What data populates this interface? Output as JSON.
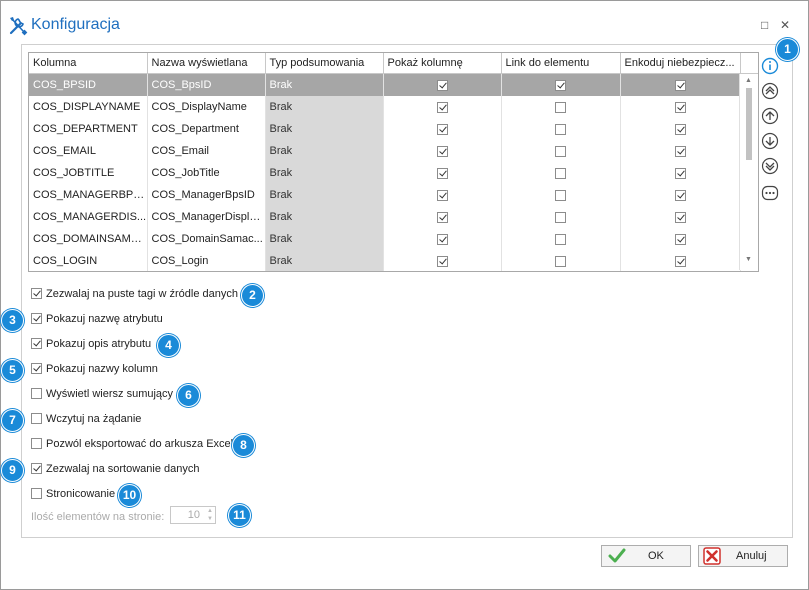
{
  "window": {
    "title": "Konfiguracja",
    "maximize_glyph": "□",
    "close_glyph": "✕"
  },
  "grid": {
    "columns": [
      "Kolumna",
      "Nazwa wyświetlana",
      "Typ podsumowania",
      "Pokaż kolumnę",
      "Link do elementu",
      "Enkoduj niebezpiecz..."
    ],
    "rows": [
      {
        "kolumna": "COS_BPSID",
        "nazwa": "COS_BpsID",
        "typ": "Brak",
        "pokaz": true,
        "link": true,
        "enkoduj": true,
        "selected": true
      },
      {
        "kolumna": "COS_DISPLAYNAME",
        "nazwa": "COS_DisplayName",
        "typ": "Brak",
        "pokaz": true,
        "link": false,
        "enkoduj": true,
        "selected": false
      },
      {
        "kolumna": "COS_DEPARTMENT",
        "nazwa": "COS_Department",
        "typ": "Brak",
        "pokaz": true,
        "link": false,
        "enkoduj": true,
        "selected": false
      },
      {
        "kolumna": "COS_EMAIL",
        "nazwa": "COS_Email",
        "typ": "Brak",
        "pokaz": true,
        "link": false,
        "enkoduj": true,
        "selected": false
      },
      {
        "kolumna": "COS_JOBTITLE",
        "nazwa": "COS_JobTitle",
        "typ": "Brak",
        "pokaz": true,
        "link": false,
        "enkoduj": true,
        "selected": false
      },
      {
        "kolumna": "COS_MANAGERBPSID",
        "nazwa": "COS_ManagerBpsID",
        "typ": "Brak",
        "pokaz": true,
        "link": false,
        "enkoduj": true,
        "selected": false
      },
      {
        "kolumna": "COS_MANAGERDIS...",
        "nazwa": "COS_ManagerDispla...",
        "typ": "Brak",
        "pokaz": true,
        "link": false,
        "enkoduj": true,
        "selected": false
      },
      {
        "kolumna": "COS_DOMAINSAMA...",
        "nazwa": "COS_DomainSamac...",
        "typ": "Brak",
        "pokaz": true,
        "link": false,
        "enkoduj": true,
        "selected": false
      },
      {
        "kolumna": "COS_LOGIN",
        "nazwa": "COS_Login",
        "typ": "Brak",
        "pokaz": true,
        "link": false,
        "enkoduj": true,
        "selected": false
      }
    ]
  },
  "side_icons": [
    "info-icon",
    "move-top-icon",
    "move-up-icon",
    "move-down-icon",
    "move-bottom-icon",
    "more-icon"
  ],
  "options": [
    {
      "label": "Zezwalaj na puste tagi w źródle danych",
      "checked": true,
      "badge": "2"
    },
    {
      "label": "Pokazuj nazwę atrybutu",
      "checked": true,
      "badge": "3"
    },
    {
      "label": "Pokazuj opis atrybutu",
      "checked": true,
      "badge": "4"
    },
    {
      "label": "Pokazuj nazwy kolumn",
      "checked": true,
      "badge": "5"
    },
    {
      "label": "Wyświetl wiersz sumujący",
      "checked": false,
      "badge": "6"
    },
    {
      "label": "Wczytuj na żądanie",
      "checked": false,
      "badge": "7"
    },
    {
      "label": "Pozwól eksportować do arkusza Excel",
      "checked": false,
      "badge": "8"
    },
    {
      "label": "Zezwalaj na sortowanie danych",
      "checked": true,
      "badge": "9"
    },
    {
      "label": "Stronicowanie",
      "checked": false,
      "badge": "10"
    }
  ],
  "paging": {
    "label": "Ilość elementów na stronie:",
    "value": "10",
    "badge": "11"
  },
  "badge_1": "1",
  "buttons": {
    "ok": "OK",
    "cancel": "Anuluj"
  },
  "colors": {
    "accent": "#1a8ad8",
    "title": "#1f6fbf",
    "selected_row": "#a6a6a6",
    "readonly_cell": "#d9d9d9",
    "ok_green": "#4caf50",
    "cancel_red": "#d0312d"
  }
}
